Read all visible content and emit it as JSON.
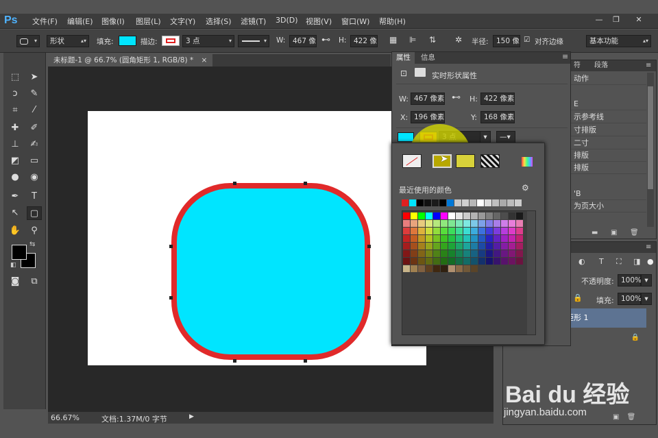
{
  "app": {
    "logo": "Ps"
  },
  "menu": [
    "文件(F)",
    "编辑(E)",
    "图像(I)",
    "图层(L)",
    "文字(Y)",
    "选择(S)",
    "滤镜(T)",
    "3D(D)",
    "视图(V)",
    "窗口(W)",
    "帮助(H)"
  ],
  "window_controls": {
    "minimize": "—",
    "restore": "❐",
    "close": "✕"
  },
  "options": {
    "tool_mode": "形状",
    "fill_label": "填充:",
    "stroke_label": "描边:",
    "stroke_width": "3 点",
    "w_label": "W:",
    "w_value": "467 像素",
    "h_label": "H:",
    "h_value": "422 像素",
    "radius_label": "半径:",
    "radius_value": "150 像",
    "align_edges_label": "对齐边缘",
    "workspace": "基本功能",
    "fill_color": "#00e5ff",
    "stroke_color": "#e02020"
  },
  "document": {
    "tab_title": "未标题-1 @ 66.7% (圆角矩形 1, RGB/8) *",
    "tab_close": "×",
    "zoom": "66.67%",
    "doc_info": "文档:1.37M/0 字节",
    "shape_fill": "#00e5ff",
    "shape_stroke": "#e02a2a"
  },
  "properties": {
    "tabs": [
      "属性",
      "信息"
    ],
    "title": "实时形状属性",
    "w_label": "W:",
    "w_value": "467 像素",
    "h_label": "H:",
    "h_value": "422 像素",
    "x_label": "X:",
    "x_value": "196 像素",
    "y_label": "Y:",
    "y_value": "168 像素",
    "stroke_width": "3 点"
  },
  "color_popup": {
    "recent_label": "最近使用的颜色",
    "recent_colors": [
      "#e02020",
      "#00e5ff",
      "#000000",
      "#111111",
      "#1a1a1a",
      "#000000",
      "#0078d7",
      "#c8c8c8",
      "#d0d0d0",
      "#b8b8b8",
      "#ffffff",
      "#dcdcdc",
      "#c0c0c0",
      "#aaaaaa",
      "#bbbbbb",
      "#cccccc"
    ]
  },
  "right_panel": {
    "tabs_partial": [
      "符",
      "段落"
    ],
    "list": [
      "动作",
      "E",
      "示参考线",
      "寸排版",
      "二寸",
      "排版",
      "排版",
      "'B",
      "为页大小"
    ]
  },
  "layers": {
    "opacity_label": "不透明度:",
    "opacity_value": "100%",
    "fill_label": "填充:",
    "fill_value": "100%",
    "items": [
      "圆角矩形 1",
      "背景"
    ]
  },
  "watermark": {
    "logo": "Bai du 经验",
    "url": "jingyan.baidu.com"
  }
}
